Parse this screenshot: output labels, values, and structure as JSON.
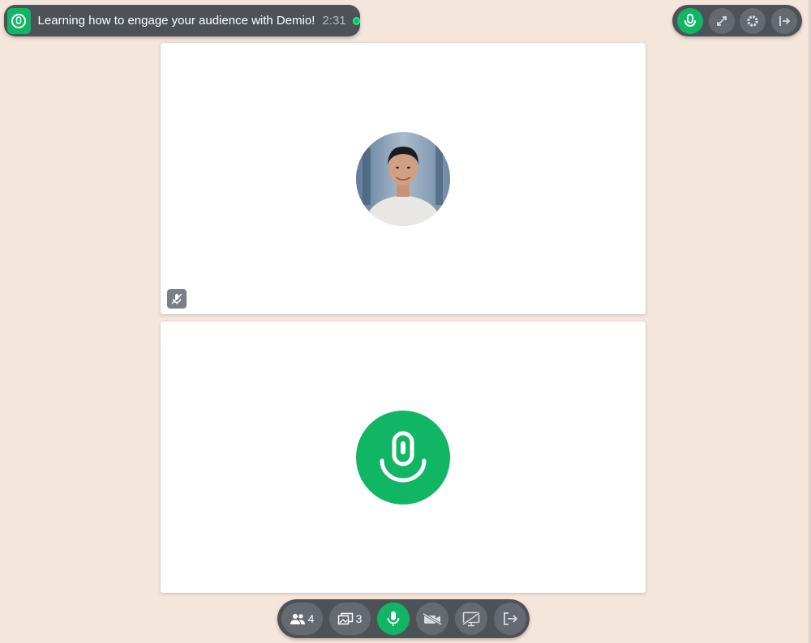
{
  "session": {
    "title": "Learning how to engage your audience with Demio!",
    "timer": "2:31"
  },
  "top_controls": [
    "microphone-icon",
    "expand-icon",
    "gear-icon",
    "exit-icon"
  ],
  "toolbar": {
    "attendees_count": "4",
    "handouts_count": "3"
  },
  "colors": {
    "accent": "#10b664",
    "toolbar_bg": "#4d5257",
    "button_bg": "#656a70",
    "page_bg": "#f5e6dc"
  }
}
